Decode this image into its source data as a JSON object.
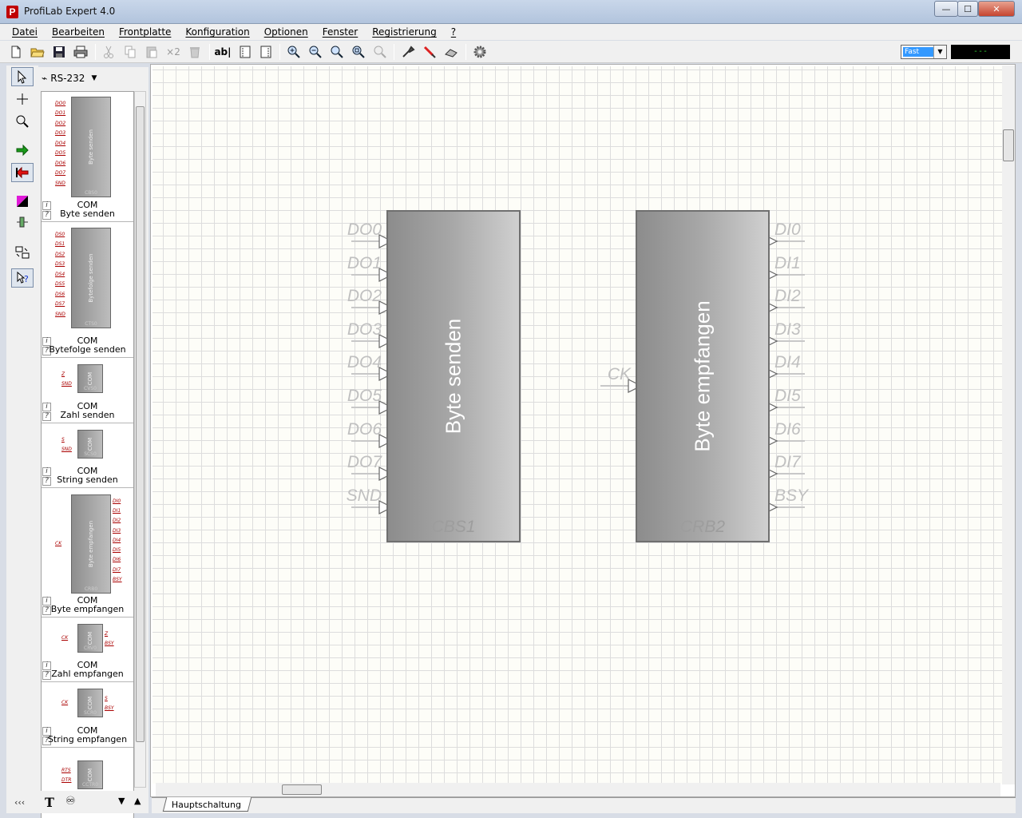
{
  "window": {
    "title": "ProfiLab Expert 4.0",
    "icon_letter": "P",
    "minimize": "—",
    "maximize": "☐",
    "close": "✕"
  },
  "menu": [
    "Datei",
    "Bearbeiten",
    "Frontplatte",
    "Konfiguration",
    "Optionen",
    "Fenster",
    "Registrierung",
    "?"
  ],
  "toolbar": {
    "x2_label": "×2",
    "abl_label": "ab|",
    "speed_value": "Fast",
    "display_value": "---"
  },
  "library": {
    "selected": "RS-232",
    "info_btn": "i",
    "help_btn": "?",
    "items": [
      {
        "category": "COM",
        "name": "Byte senden",
        "chip_title": "Byte senden",
        "chip_id": "CBS0",
        "pins_left": [
          "DO0",
          "DO1",
          "DO2",
          "DO3",
          "DO4",
          "DO5",
          "DO6",
          "DO7",
          "SND"
        ],
        "pins_right": []
      },
      {
        "category": "COM",
        "name": "Bytefolge senden",
        "chip_title": "Bytefolge senden",
        "chip_id": "CTS0",
        "pins_left": [
          "DS0",
          "DS1",
          "DS2",
          "DS3",
          "DS4",
          "DS5",
          "DS6",
          "DS7",
          "SND"
        ],
        "pins_right": []
      },
      {
        "category": "COM",
        "name": "Zahl senden",
        "chip_title": "COM",
        "chip_id": "CVS0",
        "pins_left": [
          "Z",
          "SND"
        ],
        "pins_right": []
      },
      {
        "category": "COM",
        "name": "String senden",
        "chip_title": "COM",
        "chip_id": "SCS0",
        "pins_left": [
          "S",
          "SND"
        ],
        "pins_right": []
      },
      {
        "category": "COM",
        "name": "Byte empfangen",
        "chip_title": "Byte empfangen",
        "chip_id": "CRB0",
        "pins_left": [
          "CK"
        ],
        "pins_right": [
          "DI0",
          "DI1",
          "DI2",
          "DI3",
          "DI4",
          "DI5",
          "DI6",
          "DI7",
          "BSY"
        ]
      },
      {
        "category": "COM",
        "name": "Zahl empfangen",
        "chip_title": "COM",
        "chip_id": "CRV0",
        "pins_left": [
          "CK"
        ],
        "pins_right": [
          "Z",
          "BSY"
        ]
      },
      {
        "category": "COM",
        "name": "String empfangen",
        "chip_title": "COM",
        "chip_id": "SCR0",
        "pins_left": [
          "CK"
        ],
        "pins_right": [
          "S",
          "BSY"
        ]
      },
      {
        "category": "",
        "name": "",
        "chip_title": "COM",
        "chip_id": "CCTR0",
        "pins_left": [
          "RTS",
          "DTR"
        ],
        "pins_right": []
      }
    ],
    "collapse_label": "‹‹‹"
  },
  "canvas": {
    "blocks": [
      {
        "id": "CBS1",
        "title": "Byte senden",
        "inputs": [
          "DO0",
          "DO1",
          "DO2",
          "DO3",
          "DO4",
          "DO5",
          "DO6",
          "DO7",
          "SND"
        ],
        "outputs": []
      },
      {
        "id": "CRB2",
        "title": "Byte empfangen",
        "inputs": [
          "CK"
        ],
        "outputs": [
          "DI0",
          "DI1",
          "DI2",
          "DI3",
          "DI4",
          "DI5",
          "DI6",
          "DI7",
          "BSY"
        ]
      }
    ]
  },
  "sheet_tab": "Hauptschaltung",
  "colors": {
    "accent": "#3399ff",
    "pin_label": "#c0c0c0",
    "lib_pin": "#aa0000"
  }
}
